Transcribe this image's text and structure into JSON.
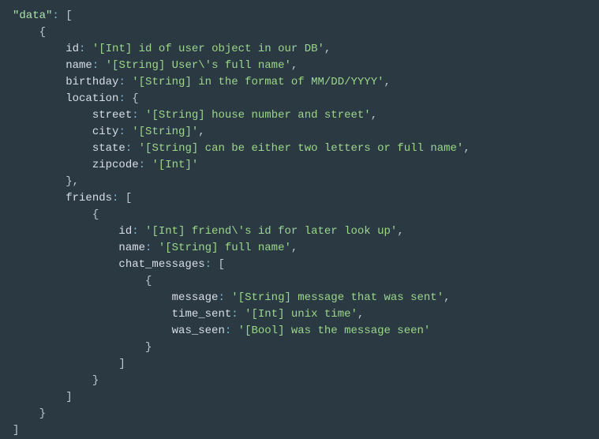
{
  "code": {
    "topKey": "\"data\"",
    "lines": {
      "l1_id_key": "id",
      "l1_id_val": "'[Int] id of user object in our DB'",
      "l2_name_key": "name",
      "l2_name_val": "'[String] User\\'s full name'",
      "l3_bday_key": "birthday",
      "l3_bday_val": "'[String] in the format of MM/DD/YYYY'",
      "l4_loc_key": "location",
      "l5_street_key": "street",
      "l5_street_val": "'[String] house number and street'",
      "l6_city_key": "city",
      "l6_city_val": "'[String]'",
      "l7_state_key": "state",
      "l7_state_val": "'[String] can be either two letters or full name'",
      "l8_zip_key": "zipcode",
      "l8_zip_val": "'[Int]'",
      "l9_friends_key": "friends",
      "l10_fid_key": "id",
      "l10_fid_val": "'[Int] friend\\'s id for later look up'",
      "l11_fname_key": "name",
      "l11_fname_val": "'[String] full name'",
      "l12_chat_key": "chat_messages",
      "l13_msg_key": "message",
      "l13_msg_val": "'[String] message that was sent'",
      "l14_ts_key": "time_sent",
      "l14_ts_val": "'[Int] unix time'",
      "l15_ws_key": "was_seen",
      "l15_ws_val": "'[Bool] was the message seen'"
    }
  }
}
